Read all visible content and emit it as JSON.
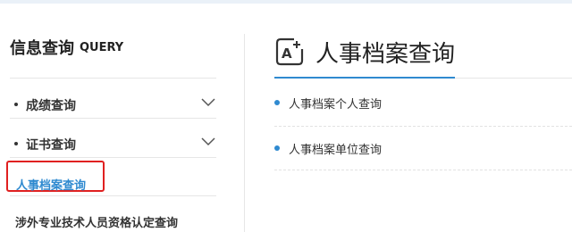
{
  "sidebar": {
    "title": "信息查询",
    "title_en": "QUERY",
    "items": [
      {
        "label": "成绩查询",
        "icon": "chevron-down-icon"
      },
      {
        "label": "证书查询",
        "icon": "chevron-down-icon"
      },
      {
        "label": "人事档案查询",
        "active": true
      },
      {
        "label": "涉外专业技术人员资格认定查询"
      }
    ]
  },
  "main": {
    "icon": "text-edit-icon",
    "title": "人事档案查询",
    "links": [
      {
        "label": "人事档案个人查询"
      },
      {
        "label": "人事档案单位查询"
      }
    ]
  },
  "colors": {
    "accent": "#2f8ad0",
    "highlight_border": "#e02020",
    "divider": "#e6e6e6"
  }
}
